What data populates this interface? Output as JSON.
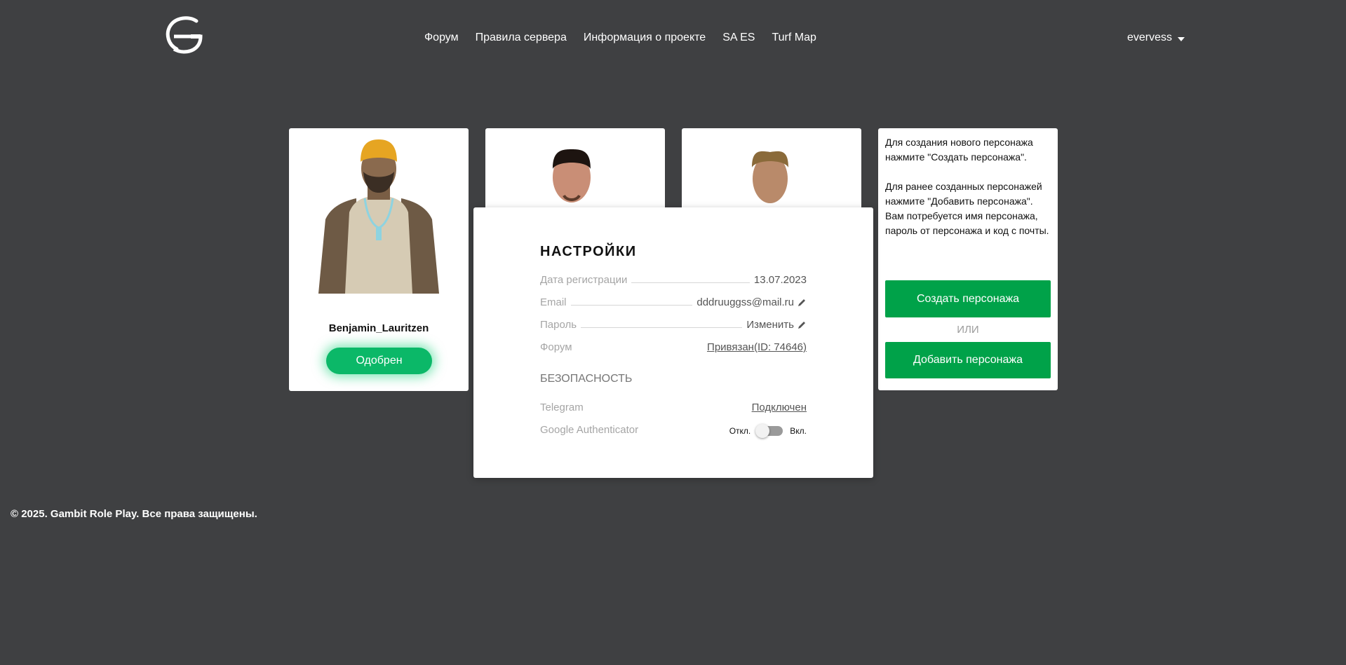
{
  "header": {
    "logo_icon": "gambit-g-logo-icon",
    "nav": [
      "Форум",
      "Правила сервера",
      "Информация о проекте",
      "SA ES",
      "Turf Map"
    ],
    "username": "evervess"
  },
  "characters": [
    {
      "name": "Benjamin_Lauritzen",
      "status": "Одобрен"
    }
  ],
  "settings": {
    "title": "НАСТРОЙКИ",
    "reg_label": "Дата регистрации",
    "reg_value": "13.07.2023",
    "email_label": "Email",
    "email_value": "dddruuggss@mail.ru",
    "password_label": "Пароль",
    "password_value": "Изменить",
    "forum_label": "Форум",
    "forum_value": "Привязан(ID: 74646)",
    "security_title": "БЕЗОПАСНОСТЬ",
    "telegram_label": "Telegram",
    "telegram_value": "Подключен",
    "ga_label": "Google Authenticator",
    "ga_off": "Откл.",
    "ga_on": "Вкл.",
    "ga_enabled": false
  },
  "info": {
    "text": "Для создания нового персонажа нажмите \"Создать персонажа\".\n\nДля ранее созданных персонажей нажмите \"Добавить персонажа\". Вам потребуется имя персонажа, пароль от персонажа и код с почты.",
    "create_button": "Создать персонажа",
    "or": "ИЛИ",
    "add_button": "Добавить персонажа"
  },
  "footer": {
    "copyright": "© 2025. Gambit Role Play. Все права защищены."
  },
  "colors": {
    "background": "#3f4042",
    "accent_green": "#00a249",
    "approved_green": "#0bb868"
  }
}
